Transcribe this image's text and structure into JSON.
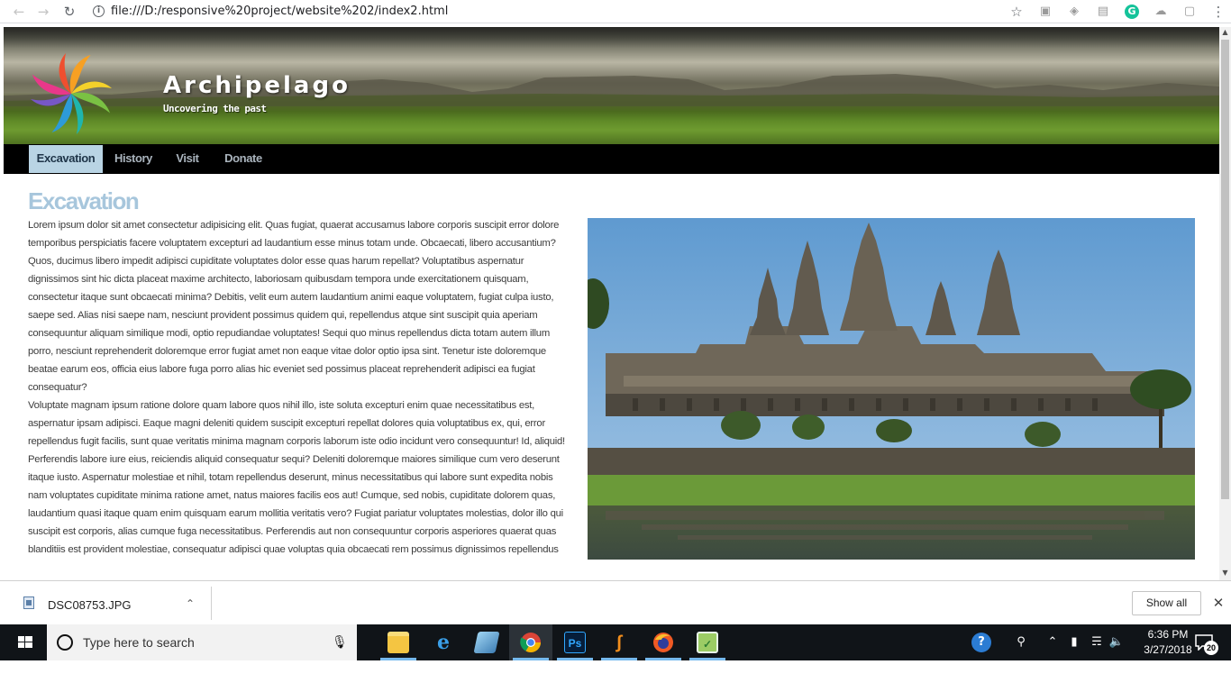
{
  "browser": {
    "url": "file:///D:/responsive%20project/website%202/index2.html",
    "back_icon": "arrow-left-icon",
    "forward_icon": "arrow-right-icon",
    "reload_icon": "reload-icon",
    "bookmark_icon": "star-icon",
    "extension_g_label": "G"
  },
  "site": {
    "title": "Archipelago",
    "tagline": "Uncovering the past",
    "nav": [
      {
        "label": "Excavation",
        "active": true
      },
      {
        "label": "History",
        "active": false
      },
      {
        "label": "Visit",
        "active": false
      },
      {
        "label": "Donate",
        "active": false
      }
    ]
  },
  "content": {
    "heading": "Excavation",
    "paragraphs": [
      "Lorem ipsum dolor sit amet consectetur adipisicing elit. Quas fugiat, quaerat accusamus labore corporis suscipit error dolore temporibus perspiciatis facere voluptatem excepturi ad laudantium esse minus totam unde. Obcaecati, libero accusantium? Quos, ducimus libero impedit adipisci cupiditate voluptates dolor esse quas harum repellat? Voluptatibus aspernatur dignissimos sint hic dicta placeat maxime architecto, laboriosam quibusdam tempora unde exercitationem quisquam, consectetur itaque sunt obcaecati minima? Debitis, velit eum autem laudantium animi eaque voluptatem, fugiat culpa iusto, saepe sed. Alias nisi saepe nam, nesciunt provident possimus quidem qui, repellendus atque sint suscipit quia aperiam consequuntur aliquam similique modi, optio repudiandae voluptates! Sequi quo minus repellendus dicta totam autem illum porro, nesciunt reprehenderit doloremque error fugiat amet non eaque vitae dolor optio ipsa sint. Tenetur iste doloremque beatae earum eos, officia eius labore fuga porro alias hic eveniet sed possimus placeat reprehenderit adipisci ea fugiat consequatur?",
      "Voluptate magnam ipsum ratione dolore quam labore quos nihil illo, iste soluta excepturi enim quae necessitatibus est, aspernatur ipsam adipisci. Eaque magni deleniti quidem suscipit excepturi repellat dolores quia voluptatibus ex, qui, error repellendus fugit facilis, sunt quae veritatis minima magnam corporis laborum iste odio incidunt vero consequuntur! Id, aliquid! Perferendis labore iure eius, reiciendis aliquid consequatur sequi? Deleniti doloremque maiores similique cum vero deserunt itaque iusto. Aspernatur molestiae et nihil, totam repellendus deserunt, minus necessitatibus qui labore sunt expedita nobis nam voluptates cupiditate minima ratione amet, natus maiores facilis eos aut! Cumque, sed nobis, cupiditate dolorem quas, laudantium quasi itaque quam enim quisquam earum mollitia veritatis vero? Fugiat pariatur voluptates molestias, dolor illo qui suscipit est corporis, alias cumque fuga necessitatibus. Perferendis aut non consequuntur corporis asperiores quaerat quas blanditiis est provident molestiae, consequatur adipisci quae voluptas quia obcaecati rem possimus dignissimos repellendus"
    ]
  },
  "download_bar": {
    "file_name": "DSC08753.JPG",
    "show_all_label": "Show all"
  },
  "taskbar": {
    "search_placeholder": "Type here to search",
    "time": "6:36 PM",
    "date": "3/27/2018",
    "notification_count": "20",
    "apps": [
      "file-explorer-icon",
      "edge-icon",
      "app-icon",
      "chrome-icon",
      "photoshop-icon",
      "visual-studio-icon",
      "firefox-icon",
      "notepad-plus-icon"
    ],
    "photoshop_label": "Ps"
  },
  "colors": {
    "nav_active_bg": "#b9d4e4",
    "heading": "#a7c6dc",
    "nav_bg": "#000000"
  }
}
